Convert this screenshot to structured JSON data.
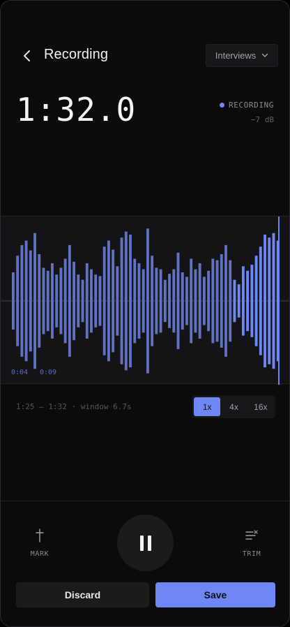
{
  "header": {
    "title": "Recording",
    "folder": "Interviews",
    "back_icon": "chevron-left-icon",
    "folder_icon": "chevron-down-icon"
  },
  "timer": {
    "elapsed": "1:32.0",
    "status": "RECORDING",
    "level": "−7 dB"
  },
  "waveform": {
    "bar_levels": [
      0.38,
      0.6,
      0.74,
      0.8,
      0.67,
      0.9,
      0.62,
      0.44,
      0.4,
      0.5,
      0.35,
      0.44,
      0.56,
      0.74,
      0.52,
      0.35,
      0.28,
      0.5,
      0.42,
      0.35,
      0.33,
      0.72,
      0.8,
      0.68,
      0.46,
      0.84,
      0.92,
      0.88,
      0.56,
      0.5,
      0.42,
      0.96,
      0.6,
      0.44,
      0.42,
      0.28,
      0.36,
      0.42,
      0.64,
      0.38,
      0.32,
      0.56,
      0.42,
      0.5,
      0.32,
      0.4,
      0.56,
      0.54,
      0.62,
      0.74,
      0.54,
      0.28,
      0.22,
      0.46,
      0.4,
      0.48,
      0.6,
      0.72,
      0.88,
      0.84,
      0.9,
      0.8
    ],
    "played_fraction": 0.83,
    "color_past": "#6272c2",
    "color_recent": "#6f86f5",
    "time_marks": [
      {
        "label": "0:04"
      },
      {
        "label": "0:09"
      }
    ]
  },
  "range": {
    "label": "1:25 – 1:32 · window 6.7s"
  },
  "zoom": {
    "options": [
      "1x",
      "4x",
      "16x"
    ],
    "selected": "1x"
  },
  "controls": {
    "mark_label": "MARK",
    "mark_icon": "dagger-icon",
    "pause_icon": "pause-icon",
    "trim_label": "TRIM",
    "trim_icon": "trim-icon"
  },
  "actions": {
    "discard_label": "Discard",
    "save_label": "Save"
  },
  "colors": {
    "accent": "#6f86f5",
    "background": "#0b0b0c",
    "panel": "#141417"
  }
}
